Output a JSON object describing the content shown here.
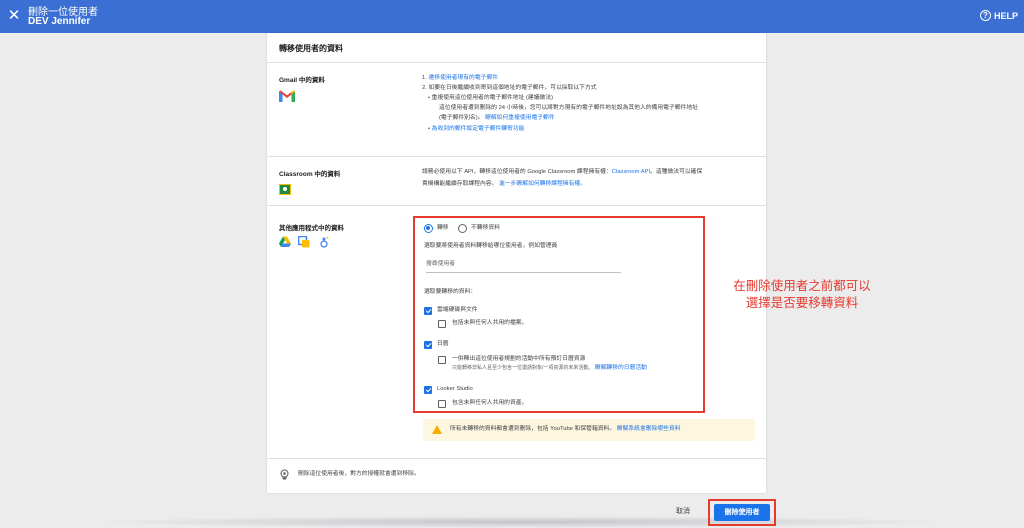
{
  "topbar": {
    "close_icon": "close-icon",
    "title": "刪除一位使用者",
    "subtitle": "DEV Jennifer",
    "help_label": "HELP",
    "help_icon": "help-icon",
    "color": "#3b6fd3"
  },
  "card": {
    "heading": "轉移使用者的資料",
    "gmail": {
      "label": "Gmail 中的資料",
      "icon": "gmail-icon",
      "item1_num": "1.",
      "item1_link": "遷移使用者現有的電子郵件",
      "item2": "2.  如要在日後繼續收到寄到這個地址的電子郵件，可以採取以下方式",
      "bullet1_title": "重複使用這位使用者的電子郵件地址 (建議做法)",
      "bullet1_desc1": "這位使用者遭到刪除的 24 小時後，您可以將對方現有的電子郵件地址設為其他人的備用電子郵件地址",
      "bullet1_desc2": "(電子郵件別名)。",
      "bullet1_link": "瞭解如何重複使用電子郵件",
      "bullet2_link": "為收到的郵件設定電子郵件轉寄功能"
    },
    "classroom": {
      "label": "Classroom 中的資料",
      "icon": "classroom-icon",
      "text1_a": "請務必使用以下 API，轉移這位使用者的 Google Classroom 課程擁有權：",
      "text1_link": "Classroom API",
      "text1_b": "。這種做法可以確保",
      "text2_a": "貴機構能繼續存取課程內容。",
      "text2_link": "進一步瞭解如何轉移課程擁有權。"
    },
    "other_apps": {
      "label": "其他應用程式中的資料",
      "icons": [
        "drive-icon",
        "looker-studio-icon",
        "calendar-icon"
      ],
      "radio_transfer": "轉移",
      "radio_no_transfer": "不轉移資料",
      "target_label": "選取要將使用者資料轉移給哪位使用者，例如管理員",
      "search_placeholder": "搜尋使用者",
      "select_data_label": "選取要轉移的資料：",
      "drive_label": "雲端硬碟與文件",
      "drive_sub": "包括未與任何人共用的檔案。",
      "calendar_label": "日曆",
      "calendar_sub1": "一併釋出這位使用者規劃的活動中所有預訂日曆資源",
      "calendar_sub2": "只能轉移非私人且至少包含一位邀請對象/一項資源的未來活動。",
      "calendar_link": "瞭解轉移的日曆活動",
      "looker_label": "Looker Studio",
      "looker_sub": "包含未與任何人共用的資產。",
      "drive_checked": true,
      "drive_sub_checked": false,
      "calendar_checked": true,
      "calendar_sub_checked": false,
      "looker_checked": true,
      "looker_sub_checked": false
    },
    "warning": {
      "icon": "warning-icon",
      "text": "所有未轉移的資料都會遭到刪除，包括 YouTube 和保管箱資料。",
      "link": "瞭解系統會刪除哪些資料"
    },
    "footer_note": {
      "icon": "revoke-icon",
      "text": "刪除這位使用者後，對方的授權就會遭到移除。"
    }
  },
  "annotation": {
    "line1": "在刪除使用者之前都可以",
    "line2": "選擇是否要移轉資料",
    "color": "#e53b2f"
  },
  "actions": {
    "cancel": "取消",
    "delete": "刪除使用者",
    "delete_color": "#1a73e8"
  }
}
